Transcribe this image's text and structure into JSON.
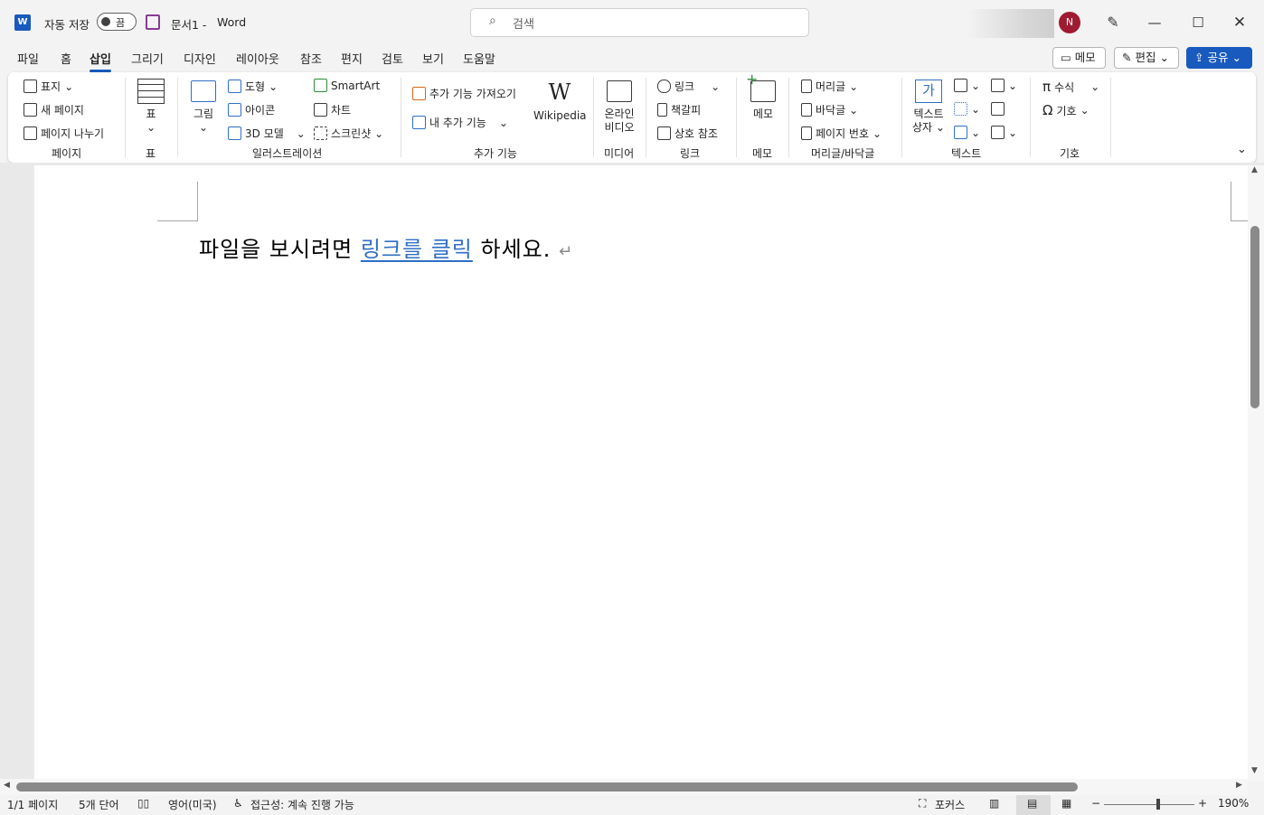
{
  "titlebar": {
    "app_logo": "W",
    "autosave_label": "자동 저장",
    "autosave_state": "끔",
    "doc_title": "문서1 -",
    "app_name": "Word",
    "search_placeholder": "검색",
    "avatar_initial": "N"
  },
  "tabs": [
    "파일",
    "홈",
    "삽입",
    "그리기",
    "디자인",
    "레이아웃",
    "참조",
    "편지",
    "검토",
    "보기",
    "도움말"
  ],
  "active_tab": "삽입",
  "right_buttons": {
    "comment": "메모",
    "edit": "편집",
    "share": "공유"
  },
  "ribbon": {
    "pages": {
      "cover": "표지",
      "new_page": "새 페이지",
      "page_break": "페이지 나누기",
      "group": "페이지"
    },
    "table": {
      "table": "표",
      "group": "표"
    },
    "illustrations": {
      "pictures": "그림",
      "shapes": "도형",
      "icons": "아이콘",
      "models_3d": "3D 모델",
      "smartart": "SmartArt",
      "chart": "차트",
      "screenshot": "스크린샷",
      "group": "일러스트레이션"
    },
    "addins": {
      "get": "추가 기능 가져오기",
      "my": "내 추가 기능",
      "wikipedia": "Wikipedia",
      "group": "추가 기능"
    },
    "media": {
      "online_video_1": "온라인",
      "online_video_2": "비디오",
      "group": "미디어"
    },
    "links": {
      "link": "링크",
      "bookmark": "책갈피",
      "cross_ref": "상호 참조",
      "group": "링크"
    },
    "comments": {
      "comment": "메모",
      "group": "메모"
    },
    "header_footer": {
      "header": "머리글",
      "footer": "바닥글",
      "page_number": "페이지 번호",
      "group": "머리글/바닥글"
    },
    "text": {
      "textbox_1": "텍스트",
      "textbox_2": "상자",
      "textbox_icon": "가",
      "group": "텍스트"
    },
    "symbols": {
      "equation": "수식",
      "symbol": "기호",
      "group": "기호"
    }
  },
  "document": {
    "before": "파일을 보시려면 ",
    "link_text": "링크를 클릭",
    "after": " 하세요.",
    "para_mark": "↵"
  },
  "status": {
    "page": "1/1 페이지",
    "words": "5개 단어",
    "language": "영어(미국)",
    "accessibility": "접근성: 계속 진행 가능",
    "focus": "포커스",
    "zoom": "190%"
  }
}
